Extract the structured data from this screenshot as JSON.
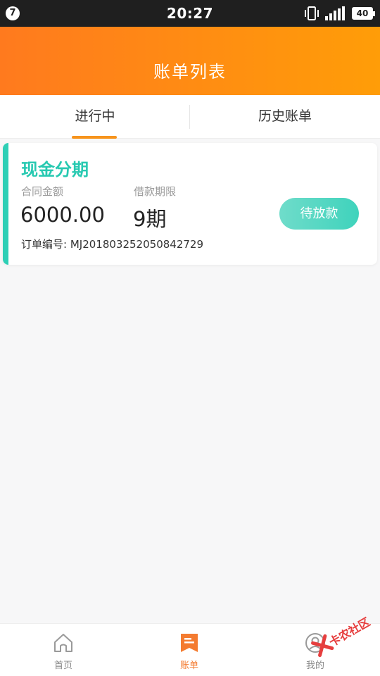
{
  "status_bar": {
    "notification_count": "7",
    "time": "20:27",
    "battery": "40"
  },
  "header": {
    "title": "账单列表"
  },
  "tabs": [
    {
      "label": "进行中",
      "active": true
    },
    {
      "label": "历史账单",
      "active": false
    }
  ],
  "bill_card": {
    "title": "现金分期",
    "amount_label": "合同金额",
    "amount_value": "6000.00",
    "term_label": "借款期限",
    "term_value": "9期",
    "order_label": "订单编号:",
    "order_number": "MJ201803252050842729",
    "status": "待放款"
  },
  "bottom_nav": [
    {
      "label": "首页",
      "icon": "home-icon",
      "active": false
    },
    {
      "label": "账单",
      "icon": "bill-icon",
      "active": true
    },
    {
      "label": "我的",
      "icon": "user-icon",
      "active": false
    }
  ],
  "watermark": {
    "text": "卡农社区"
  },
  "colors": {
    "header_start": "#ff7a1e",
    "header_end": "#ff9d08",
    "accent_teal": "#27c9b1",
    "tab_underline": "#f7941d",
    "nav_active": "#f47b30"
  }
}
